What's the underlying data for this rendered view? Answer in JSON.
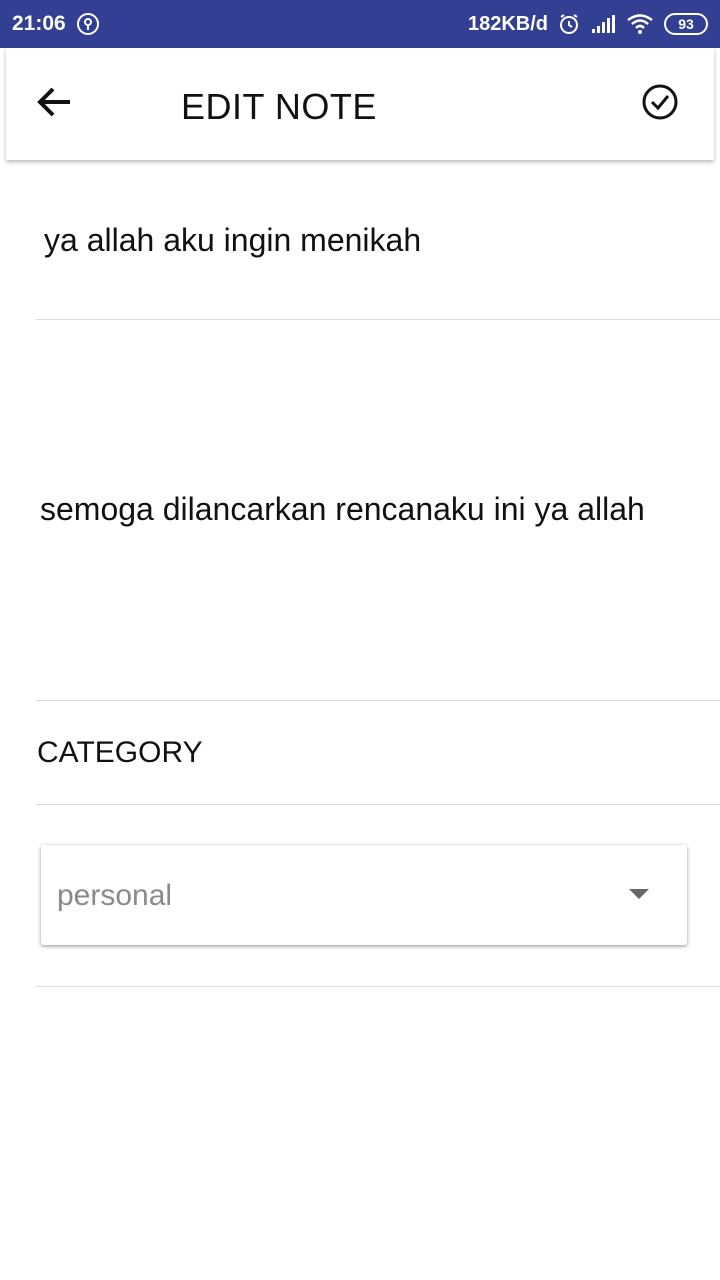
{
  "status_bar": {
    "time": "21:06",
    "network_speed": "182KB/d",
    "battery": "93",
    "icons": [
      "location-icon",
      "alarm-icon",
      "signal-icon",
      "wifi-icon",
      "battery-icon"
    ]
  },
  "app_bar": {
    "title": "EDIT NOTE",
    "back_icon": "back-arrow-icon",
    "save_icon": "check-circle-icon"
  },
  "note": {
    "title": "ya allah aku ingin menikah",
    "body": "semoga dilancarkan rencanaku ini ya allah"
  },
  "category": {
    "label": "CATEGORY",
    "selected": "personal"
  },
  "colors": {
    "status_bar": "#323f93",
    "background": "#ffffff",
    "divider": "#dcdcdc",
    "dropdown_text": "#8a8a8a"
  }
}
